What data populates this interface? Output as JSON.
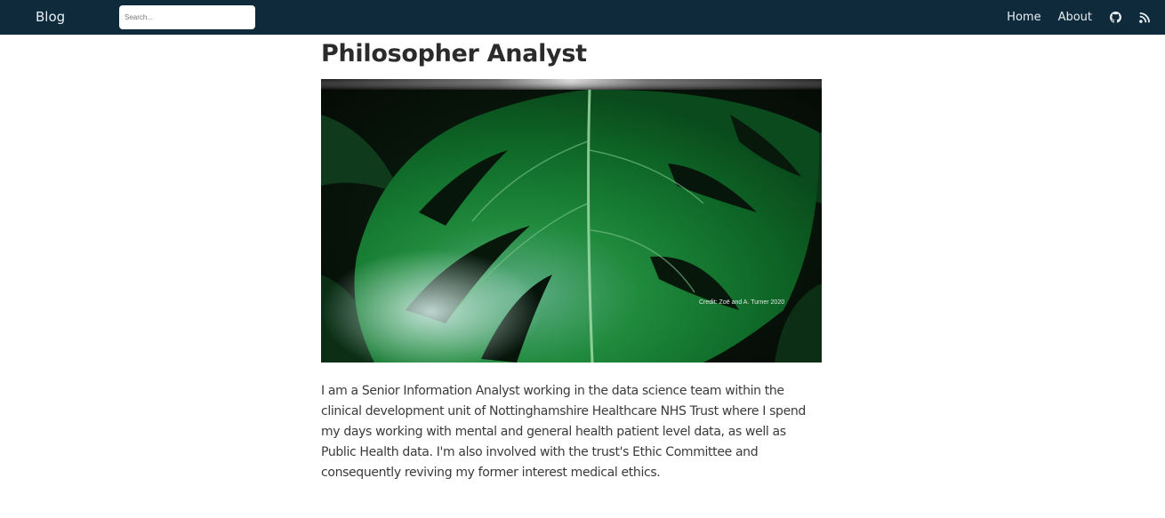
{
  "navbar": {
    "brand": "Blog",
    "search_placeholder": "Search...",
    "links": [
      {
        "label": "Home"
      },
      {
        "label": "About"
      }
    ],
    "icons": [
      "github-icon",
      "rss-icon"
    ],
    "background_color": "#0e2a3b"
  },
  "post": {
    "title": "Philosopher Analyst",
    "image": {
      "subject": "monstera-leaf",
      "credit": "Credit: Zoë and A. Turner 2020"
    },
    "bio": "I am a Senior Information Analyst working in the data science team within the clinical development unit of Nottinghamshire Healthcare NHS Trust where I spend my days working with mental and general health patient level data, as well as Public Health data. I'm also involved with the trust's Ethic Committee and consequently reviving my former interest medical ethics."
  }
}
